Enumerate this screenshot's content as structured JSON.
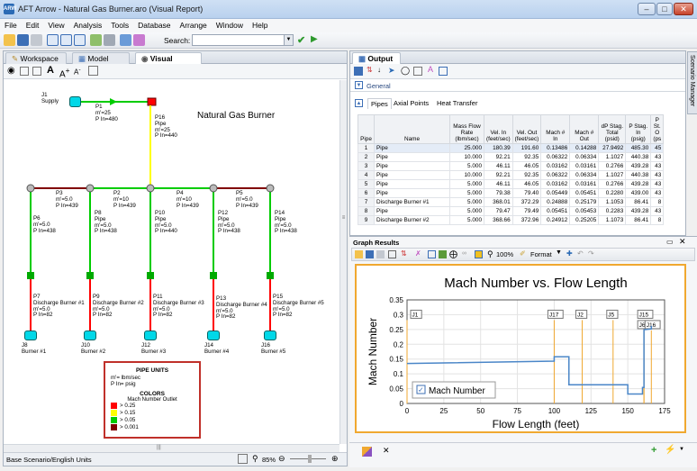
{
  "window": {
    "title": "AFT Arrow - Natural Gas Burner.aro (Visual Report)",
    "app_icon": "ARW"
  },
  "menu": [
    "File",
    "Edit",
    "View",
    "Analysis",
    "Tools",
    "Database",
    "Arrange",
    "Window",
    "Help"
  ],
  "toolbar": {
    "search_label": "Search:",
    "search_value": ""
  },
  "left_tabs": [
    "Workspace",
    "Model Data",
    "Visual Report"
  ],
  "diagram": {
    "title": "Natural Gas Burner",
    "supply": {
      "name": "J1",
      "label": "Supply"
    },
    "pipes": [
      {
        "id": "P1",
        "text": "P1\nm'=25\nP In=480"
      },
      {
        "id": "P16",
        "text": "P16\nPipe\nm'=25\nP In=440"
      },
      {
        "id": "P3",
        "text": "P3\nm'=5.0\nP In=439"
      },
      {
        "id": "P2",
        "text": "P2\nm'=10\nP In=439"
      },
      {
        "id": "P4",
        "text": "P4\nm'=10\nP In=439"
      },
      {
        "id": "P5",
        "text": "P5\nm'=5.0\nP In=439"
      },
      {
        "id": "P6",
        "text": "P6\nm'=5.0\nP In=438"
      },
      {
        "id": "P8",
        "text": "P8\nPipe\nm'=5.0\nP In=438"
      },
      {
        "id": "P10",
        "text": "P10\nPipe\nm'=5.0\nP In=440"
      },
      {
        "id": "P12",
        "text": "P12\nPipe\nm'=5.0\nP In=438"
      },
      {
        "id": "P14",
        "text": "P14\nPipe\nm'=5.0\nP In=438"
      },
      {
        "id": "P7",
        "text": "P7\nDischarge Burner #1\nm'=5.0\nP In=82"
      },
      {
        "id": "P9",
        "text": "P9\nDischarge Burner #2\nm'=5.0\nP In=82"
      },
      {
        "id": "P11",
        "text": "P11\nDischarge Burner #3\nm'=5.0\nP In=82"
      },
      {
        "id": "P13",
        "text": "P13\nDischarge Burner #4\nm'=5.0\nP In=82"
      },
      {
        "id": "P15",
        "text": "P15\nDischarge Burner #5\nm'=5.0\nP In=82"
      }
    ],
    "burners": [
      {
        "id": "J8",
        "label": "J8\nBurner #1"
      },
      {
        "id": "J10",
        "label": "J10\nBurner #2"
      },
      {
        "id": "J12",
        "label": "J12\nBurner #3"
      },
      {
        "id": "J14",
        "label": "J14\nBurner #4"
      },
      {
        "id": "J16",
        "label": "J16\nBurner #5"
      }
    ],
    "legend": {
      "units_title": "PIPE UNITS",
      "units": "m'= lbm/sec\nP In= psig",
      "colors_title": "COLORS",
      "colors_sub": "Mach Number Outlet",
      "items": [
        {
          "label": "> 0.25",
          "color": "#ff0000"
        },
        {
          "label": "> 0.15",
          "color": "#ffff00"
        },
        {
          "label": "> 0.05",
          "color": "#00cc00"
        },
        {
          "label": "> 0.001",
          "color": "#800000"
        }
      ]
    }
  },
  "status": {
    "text": "Base Scenario/English Units",
    "zoom": "85%"
  },
  "output": {
    "title": "Output",
    "general_label": "General",
    "tabs": [
      "Pipes",
      "Axial Points",
      "Heat Transfer"
    ],
    "side_label": "Scenario Manager",
    "columns": [
      "Pipe",
      "Name",
      "Mass Flow Rate (lbm/sec)",
      "Vel. In (feet/sec)",
      "Vel. Out (feet/sec)",
      "Mach # In",
      "Mach # Out",
      "dP Stag. Total (psid)",
      "P Stag. In (psig)",
      "P St. O (ps"
    ],
    "rows": [
      [
        "1",
        "Pipe",
        "25.000",
        "180.39",
        "191.60",
        "0.13486",
        "0.14288",
        "27.9492",
        "485.30",
        "45"
      ],
      [
        "2",
        "Pipe",
        "10.000",
        "92.21",
        "92.35",
        "0.06322",
        "0.06334",
        "1.1027",
        "440.38",
        "43"
      ],
      [
        "3",
        "Pipe",
        "5.000",
        "46.11",
        "46.05",
        "0.03162",
        "0.03161",
        "0.2766",
        "439.28",
        "43"
      ],
      [
        "4",
        "Pipe",
        "10.000",
        "92.21",
        "92.35",
        "0.06322",
        "0.06334",
        "1.1027",
        "440.38",
        "43"
      ],
      [
        "5",
        "Pipe",
        "5.000",
        "46.11",
        "46.05",
        "0.03162",
        "0.03161",
        "0.2766",
        "439.28",
        "43"
      ],
      [
        "6",
        "Pipe",
        "5.000",
        "79.38",
        "79.40",
        "0.05449",
        "0.05451",
        "0.2280",
        "439.00",
        "43"
      ],
      [
        "7",
        "Discharge Burner #1",
        "5.000",
        "368.01",
        "372.29",
        "0.24888",
        "0.25179",
        "1.1053",
        "86.41",
        "8"
      ],
      [
        "8",
        "Pipe",
        "5.000",
        "79.47",
        "79.49",
        "0.05451",
        "0.05453",
        "0.2283",
        "439.28",
        "43"
      ],
      [
        "9",
        "Discharge Burner #2",
        "5.000",
        "368.66",
        "372.96",
        "0.24912",
        "0.25205",
        "1.1073",
        "86.41",
        "8"
      ]
    ]
  },
  "graph": {
    "window_title": "Graph Results",
    "zoom": "100%",
    "format_label": "Format"
  },
  "chart_data": {
    "type": "line",
    "title": "Mach Number vs. Flow Length",
    "xlabel": "Flow Length (feet)",
    "ylabel": "Mach Number",
    "xlim": [
      0,
      175
    ],
    "ylim": [
      0,
      0.35
    ],
    "xticks": [
      0,
      25,
      50,
      75,
      100,
      125,
      150,
      175
    ],
    "yticks": [
      0,
      0.05,
      0.1,
      0.15,
      0.2,
      0.25,
      0.3,
      0.35
    ],
    "grid": true,
    "legend": "bottom-left",
    "series": [
      {
        "name": "Mach Number",
        "color": "#4a86c8",
        "x": [
          0,
          100,
          100,
          110,
          110,
          119,
          119,
          140,
          140,
          150,
          150,
          160,
          160,
          161,
          161,
          166,
          166,
          166.5,
          166.5
        ],
        "y": [
          0.135,
          0.143,
          0.158,
          0.158,
          0.063,
          0.063,
          0.063,
          0.063,
          0.063,
          0.063,
          0.032,
          0.032,
          0.054,
          0.054,
          0.249,
          0.252,
          0.26,
          0.26,
          0.26
        ]
      }
    ],
    "markers": [
      {
        "label": "J1",
        "x": 0,
        "y": 0.3
      },
      {
        "label": "J17",
        "x": 100,
        "y": 0.3
      },
      {
        "label": "J2",
        "x": 119,
        "y": 0.3
      },
      {
        "label": "J5",
        "x": 140,
        "y": 0.3
      },
      {
        "label": "J15",
        "x": 161,
        "y": 0.3
      },
      {
        "label": "J6",
        "x": 161,
        "y": 0.265
      },
      {
        "label": "J16",
        "x": 166,
        "y": 0.265
      }
    ]
  }
}
